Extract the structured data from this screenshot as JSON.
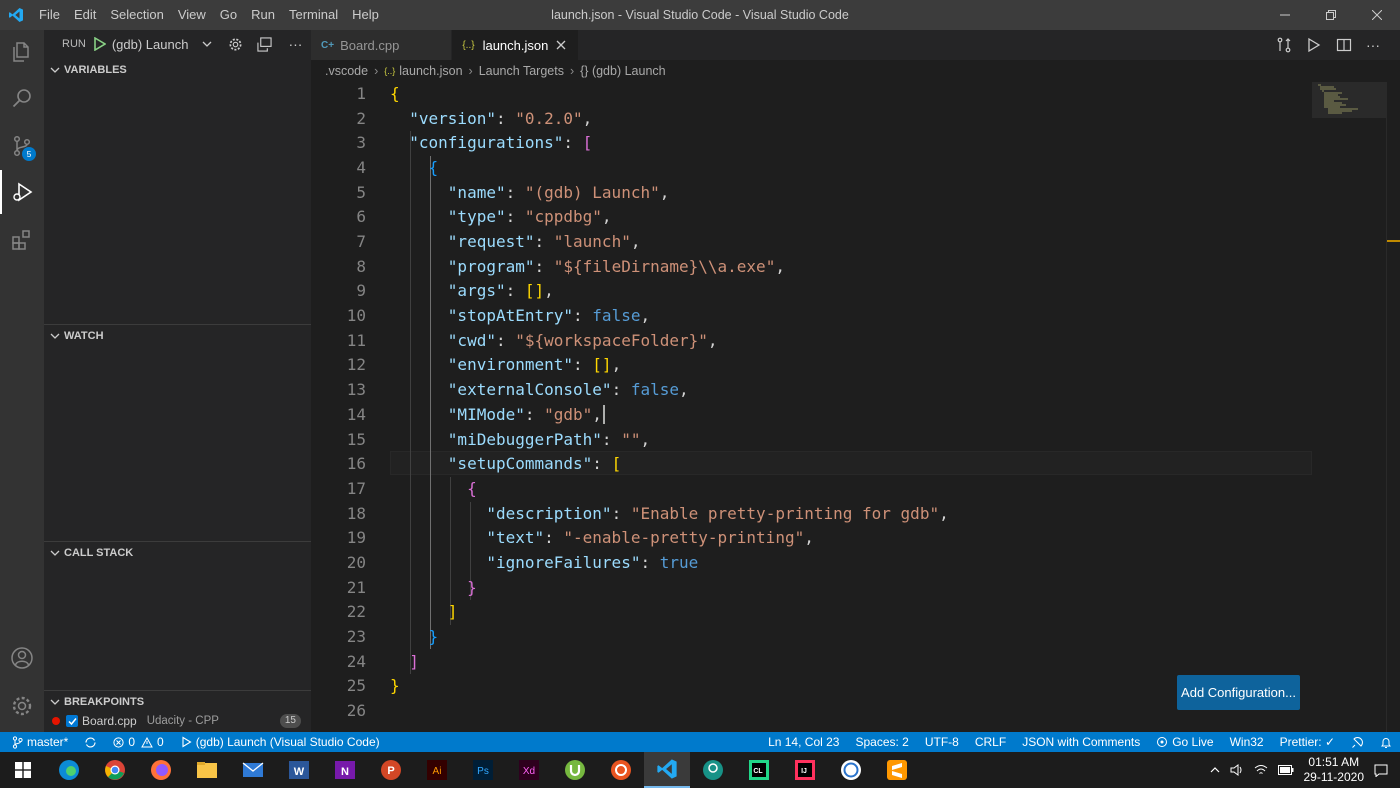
{
  "titlebar": {
    "menu": [
      "File",
      "Edit",
      "Selection",
      "View",
      "Go",
      "Run",
      "Terminal",
      "Help"
    ],
    "title": "launch.json - Visual Studio Code - Visual Studio Code"
  },
  "activity": {
    "scm_badge": "5"
  },
  "sidebar": {
    "run_label": "RUN",
    "launch_config": "(gdb) Launch",
    "sections": {
      "variables": "VARIABLES",
      "watch": "WATCH",
      "call_stack": "CALL STACK",
      "breakpoints": "BREAKPOINTS"
    },
    "breakpoint": {
      "file": "Board.cpp",
      "folder": "Udacity - CPP",
      "line": "15",
      "checked": true
    }
  },
  "tabs": [
    {
      "label": "Board.cpp",
      "icon": "cpp-file-icon"
    },
    {
      "label": "launch.json",
      "icon": "json-file-icon"
    }
  ],
  "breadcrumb": [
    ".vscode",
    "launch.json",
    "Launch Targets",
    "{} (gdb) Launch"
  ],
  "editor": {
    "lines": [
      [
        [
          "br1",
          "{"
        ]
      ],
      [
        [
          "p",
          "  "
        ],
        [
          "k",
          "\"version\""
        ],
        [
          "p",
          ": "
        ],
        [
          "s",
          "\"0.2.0\""
        ],
        [
          "p",
          ","
        ]
      ],
      [
        [
          "p",
          "  "
        ],
        [
          "k",
          "\"configurations\""
        ],
        [
          "p",
          ": "
        ],
        [
          "br2",
          "["
        ]
      ],
      [
        [
          "p",
          "    "
        ],
        [
          "br3",
          "{"
        ]
      ],
      [
        [
          "p",
          "      "
        ],
        [
          "k",
          "\"name\""
        ],
        [
          "p",
          ": "
        ],
        [
          "s",
          "\"(gdb) Launch\""
        ],
        [
          "p",
          ","
        ]
      ],
      [
        [
          "p",
          "      "
        ],
        [
          "k",
          "\"type\""
        ],
        [
          "p",
          ": "
        ],
        [
          "s",
          "\"cppdbg\""
        ],
        [
          "p",
          ","
        ]
      ],
      [
        [
          "p",
          "      "
        ],
        [
          "k",
          "\"request\""
        ],
        [
          "p",
          ": "
        ],
        [
          "s",
          "\"launch\""
        ],
        [
          "p",
          ","
        ]
      ],
      [
        [
          "p",
          "      "
        ],
        [
          "k",
          "\"program\""
        ],
        [
          "p",
          ": "
        ],
        [
          "s",
          "\"${fileDirname}\\\\a.exe\""
        ],
        [
          "p",
          ","
        ]
      ],
      [
        [
          "p",
          "      "
        ],
        [
          "k",
          "\"args\""
        ],
        [
          "p",
          ": "
        ],
        [
          "br1",
          "[]"
        ],
        [
          "p",
          ","
        ]
      ],
      [
        [
          "p",
          "      "
        ],
        [
          "k",
          "\"stopAtEntry\""
        ],
        [
          "p",
          ": "
        ],
        [
          "b",
          "false"
        ],
        [
          "p",
          ","
        ]
      ],
      [
        [
          "p",
          "      "
        ],
        [
          "k",
          "\"cwd\""
        ],
        [
          "p",
          ": "
        ],
        [
          "s",
          "\"${workspaceFolder}\""
        ],
        [
          "p",
          ","
        ]
      ],
      [
        [
          "p",
          "      "
        ],
        [
          "k",
          "\"environment\""
        ],
        [
          "p",
          ": "
        ],
        [
          "br1",
          "[]"
        ],
        [
          "p",
          ","
        ]
      ],
      [
        [
          "p",
          "      "
        ],
        [
          "k",
          "\"externalConsole\""
        ],
        [
          "p",
          ": "
        ],
        [
          "b",
          "false"
        ],
        [
          "p",
          ","
        ]
      ],
      [
        [
          "p",
          "      "
        ],
        [
          "k",
          "\"MIMode\""
        ],
        [
          "p",
          ": "
        ],
        [
          "s",
          "\"gdb\""
        ],
        [
          "p",
          ","
        ]
      ],
      [
        [
          "p",
          "      "
        ],
        [
          "k",
          "\"miDebuggerPath\""
        ],
        [
          "p",
          ": "
        ],
        [
          "s",
          "\"\""
        ],
        [
          "p",
          ","
        ]
      ],
      [
        [
          "p",
          "      "
        ],
        [
          "k",
          "\"setupCommands\""
        ],
        [
          "p",
          ": "
        ],
        [
          "br1",
          "["
        ]
      ],
      [
        [
          "p",
          "        "
        ],
        [
          "br2",
          "{"
        ]
      ],
      [
        [
          "p",
          "          "
        ],
        [
          "k",
          "\"description\""
        ],
        [
          "p",
          ": "
        ],
        [
          "s",
          "\"Enable pretty-printing for gdb\""
        ],
        [
          "p",
          ","
        ]
      ],
      [
        [
          "p",
          "          "
        ],
        [
          "k",
          "\"text\""
        ],
        [
          "p",
          ": "
        ],
        [
          "s",
          "\"-enable-pretty-printing\""
        ],
        [
          "p",
          ","
        ]
      ],
      [
        [
          "p",
          "          "
        ],
        [
          "k",
          "\"ignoreFailures\""
        ],
        [
          "p",
          ": "
        ],
        [
          "b",
          "true"
        ]
      ],
      [
        [
          "p",
          "        "
        ],
        [
          "br2",
          "}"
        ]
      ],
      [
        [
          "p",
          "      "
        ],
        [
          "br1",
          "]"
        ]
      ],
      [
        [
          "p",
          "    "
        ],
        [
          "br3",
          "}"
        ]
      ],
      [
        [
          "p",
          "  "
        ],
        [
          "br2",
          "]"
        ]
      ],
      [
        [
          "br1",
          "}"
        ]
      ],
      []
    ],
    "add_config_label": "Add Configuration..."
  },
  "statusbar": {
    "branch": "master*",
    "errors": "0",
    "warnings": "0",
    "debug": "(gdb) Launch (Visual Studio Code)",
    "position": "Ln 14, Col 23",
    "spaces": "Spaces: 2",
    "encoding": "UTF-8",
    "eol": "CRLF",
    "language": "JSON with Comments",
    "golive": "Go Live",
    "platform": "Win32",
    "prettier": "Prettier: ✓"
  },
  "taskbar": {
    "time": "01:51 AM",
    "date": "29-11-2020",
    "apps": [
      "edge-icon",
      "chrome-icon",
      "firefox-icon",
      "file-explorer-icon",
      "mail-icon",
      "word-icon",
      "onenote-icon",
      "powerpoint-icon",
      "illustrator-icon",
      "photoshop-icon",
      "xd-icon",
      "utorrent-icon",
      "ubuntu-icon",
      "vscode-icon",
      "gitkraken-icon",
      "clion-icon",
      "intellij-icon",
      "whatsapp-icon",
      "sublime-icon"
    ]
  },
  "colors": {
    "accent": "#007acc",
    "key": "#9cdcfe",
    "string": "#ce9178",
    "keyword": "#569cd6"
  }
}
